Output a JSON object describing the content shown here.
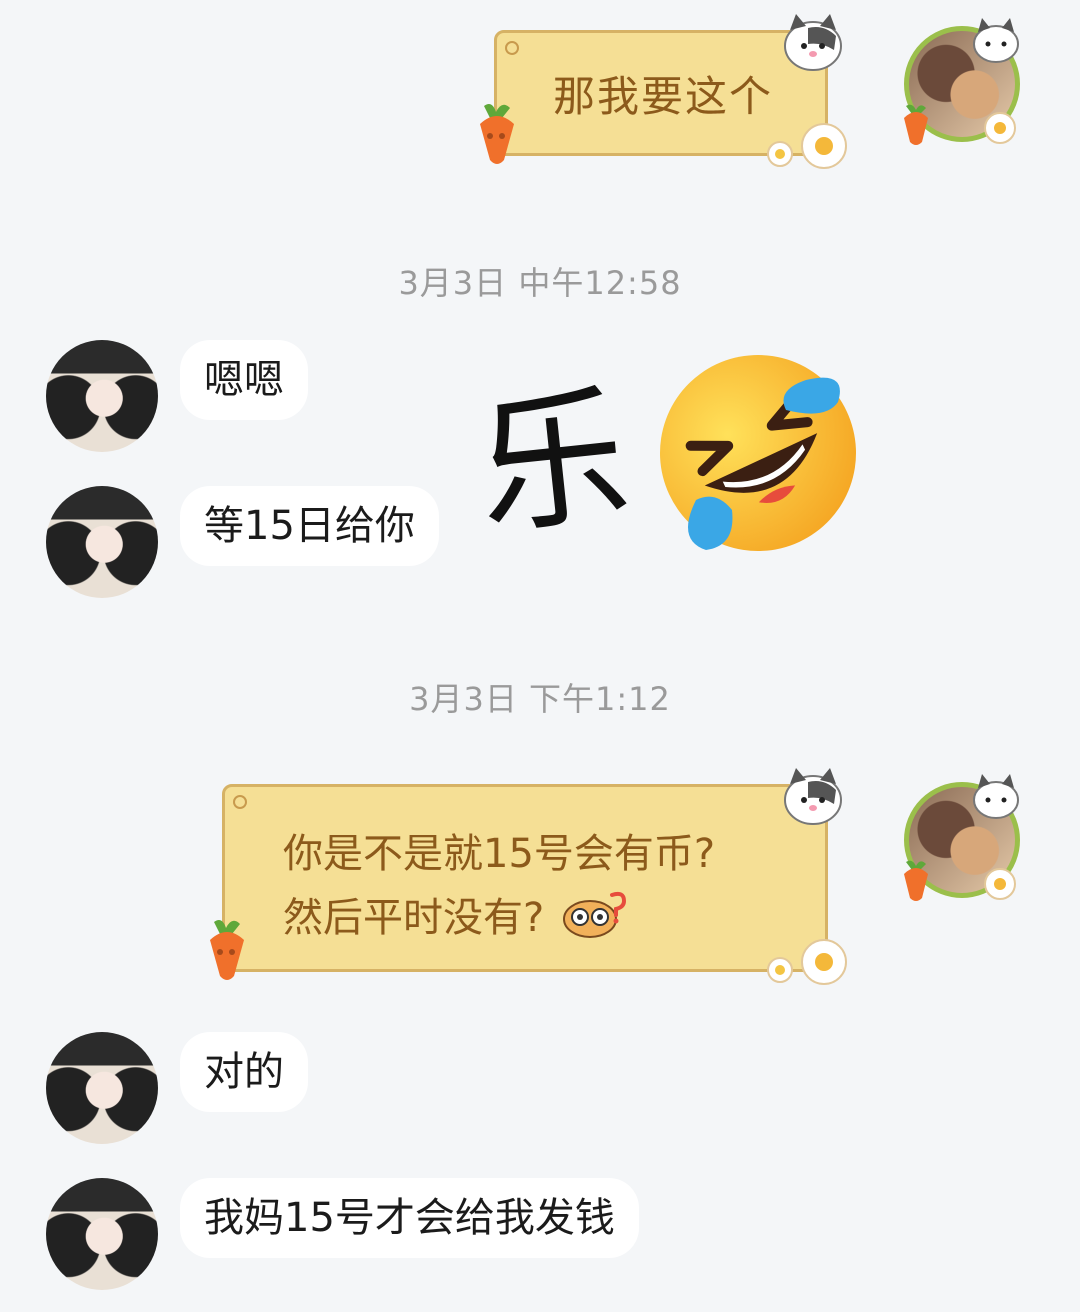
{
  "messages": [
    {
      "side": "out",
      "text": "那我要这个"
    },
    {
      "timestamp": "3月3日 中午12:58"
    },
    {
      "side": "in",
      "text": "嗯嗯"
    },
    {
      "side": "in",
      "text": "等15日给你"
    },
    {
      "side": "in",
      "sticker_text": "乐",
      "sticker_emoji": "🤣"
    },
    {
      "timestamp": "3月3日 下午1:12"
    },
    {
      "side": "out",
      "lines": [
        "你是不是就15号会有币?",
        "然后平时没有?"
      ],
      "inline_emoji": "❓"
    },
    {
      "side": "in",
      "text": "对的"
    },
    {
      "side": "in",
      "text": "我妈15号才会给我发钱"
    }
  ],
  "colors": {
    "background": "#f4f6f8",
    "incoming_bubble": "#ffffff",
    "outgoing_bubble": "#f5df95",
    "outgoing_text": "#8c5a1b",
    "timestamp_text": "#9a9a9a"
  },
  "icons": [
    "avatar-her",
    "avatar-me",
    "carrot-icon",
    "cat-icon",
    "egg-icon",
    "laughing-crying-emoji",
    "question-owl-icon"
  ]
}
